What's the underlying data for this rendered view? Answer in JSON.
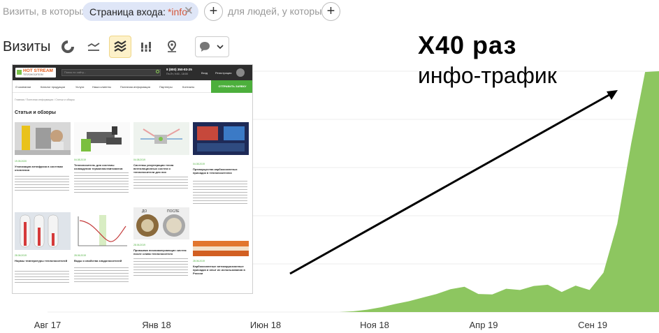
{
  "filter": {
    "visits_where": "Визиты, в которых",
    "segment_name": "Страница входа:",
    "segment_value": "*info*",
    "for_people": "для людей, у которых",
    "add_symbol": "+",
    "remove_symbol": "✕"
  },
  "toolbar": {
    "title": "Визиты",
    "chart_types": [
      "pie-chart-icon",
      "line-chart-icon",
      "area-chart-icon",
      "bar-chart-icon",
      "map-pin-icon"
    ],
    "active_type": "area-chart-icon",
    "comment_icon": "comment-icon",
    "dropdown_icon": "chevron-down-icon"
  },
  "annotation": {
    "title": "X40 раз",
    "subtitle": "инфо-трафик"
  },
  "chart_data": {
    "type": "area",
    "x_labels": [
      "Авг 17",
      "Янв 18",
      "Июн 18",
      "Ноя 18",
      "Апр 19",
      "Сен 19"
    ],
    "values": [
      0,
      0,
      0,
      0,
      0,
      0,
      0,
      0,
      0,
      0,
      0,
      0,
      0,
      0,
      0,
      0,
      0,
      0,
      0,
      0,
      0,
      0,
      2,
      6,
      12,
      20,
      27,
      36,
      45,
      57,
      63,
      45,
      44,
      58,
      55,
      65,
      68,
      50,
      66,
      55,
      98,
      220,
      420,
      598,
      600
    ],
    "ylim": [
      0,
      600
    ],
    "color": "#8dc660",
    "grid": true
  },
  "colors": {
    "accent_area": "#8dc660",
    "chip_bg": "#dfe6f7",
    "segment_value": "#d4573a",
    "site_green": "#4caf3c"
  },
  "site": {
    "logo": "HOT STREAM",
    "logo_sub": "ТЕПЛОНОСИТЕЛИ",
    "search_placeholder": "Поиск по сайту...",
    "phone": "8 (800) 350-83-25",
    "hours": "Пн-Пт, 9:00 - 18:00",
    "login": "Вход",
    "register": "Регистрация",
    "nav": [
      "О компании",
      "Каталог продукции",
      "Услуги",
      "Наши клиенты",
      "Полезная информация",
      "Партнеры",
      "Контакты"
    ],
    "cta": "ОТПРАВИТЬ ЗАЯВКУ",
    "breadcrumb": "Главная  /  Полезная информация  /  Статьи и обзоры",
    "heading": "Статьи и обзоры",
    "cards": [
      {
        "date": "19.05.2020",
        "title": "Утилизация антифриза в системах отопления"
      },
      {
        "date": "04.08.2019",
        "title": "Теплоноситель для системы охлаждения термопластавтоматов"
      },
      {
        "date": "04.08.2019",
        "title": "Системы рекуперации тепла вентиляционных систем и теплоносители для них"
      },
      {
        "date": "04.08.2019",
        "title": "Преимущества карбоксилатных присадок в теплоносителях"
      },
      {
        "date": "28.06.2019",
        "title": "Нормы температуры теплоносителей"
      },
      {
        "date": "28.06.2019",
        "title": "Воды и свойства хладоносителей"
      },
      {
        "date": "28.06.2019",
        "title": "Промывка низкозамерзающих систем после слива теплоносителя"
      },
      {
        "date": "28.06.2019",
        "title": "Карбоксилатные антикоррозионные присадки и опыт их использования в России"
      }
    ],
    "before_label": "ДО",
    "after_label": "ПОСЛЕ"
  }
}
